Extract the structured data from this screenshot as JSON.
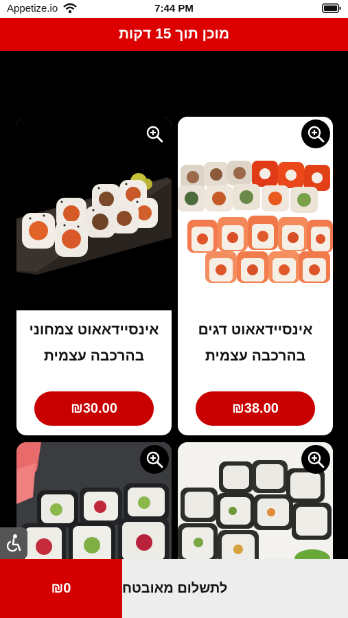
{
  "status_bar": {
    "carrier": "Appetize.io",
    "time": "7:44 PM"
  },
  "header": {
    "title": "מוכן תוך 15 דקות"
  },
  "products": [
    {
      "title": "אינסיידאאוט דגים בהרכבה עצמית",
      "price": "₪38.00",
      "image": "salmon-sushi-platter"
    },
    {
      "title": "אינסיידאאוט צמחוני בהרכבה עצמית",
      "price": "₪30.00",
      "image": "vegetarian-inside-out-rolls"
    },
    {
      "title": "",
      "price": "",
      "image": "futomaki-rolls"
    },
    {
      "title": "",
      "price": "",
      "image": "tuna-nori-rolls"
    }
  ],
  "cart": {
    "total": "₪0",
    "checkout_label": "לתשלום מאובטח"
  },
  "colors": {
    "brand_red": "#dd0000",
    "price_red": "#c80000",
    "background": "#000000"
  },
  "icons": [
    "wifi-icon",
    "battery-icon",
    "zoom-in-icon",
    "accessibility-icon"
  ]
}
